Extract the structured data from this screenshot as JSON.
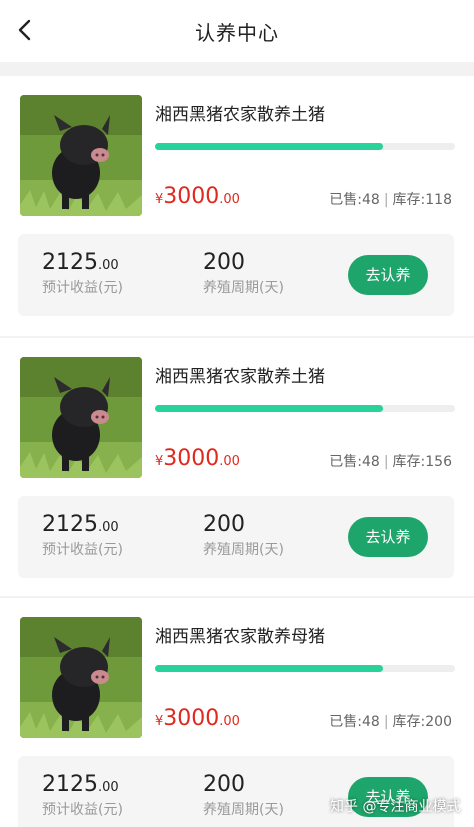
{
  "nav": {
    "title": "认养中心",
    "back_icon": "chevron-left-icon"
  },
  "colors": {
    "accent": "#27d39a",
    "button": "#1ea56b",
    "price": "#e0281e"
  },
  "cards": [
    {
      "name": "湘西黑猪农家散养土猪",
      "progress_percent": 76,
      "price": {
        "currency": "¥",
        "integer": "3000",
        "decimal": ".00"
      },
      "sold_label": "已售:48",
      "stock_label": "库存:118",
      "income": {
        "integer": "2125",
        "decimal": ".00",
        "label": "预计收益(元)"
      },
      "period": {
        "value": "200",
        "label": "养殖周期(天)"
      },
      "button": "去认养"
    },
    {
      "name": "湘西黑猪农家散养土猪",
      "progress_percent": 76,
      "price": {
        "currency": "¥",
        "integer": "3000",
        "decimal": ".00"
      },
      "sold_label": "已售:48",
      "stock_label": "库存:156",
      "income": {
        "integer": "2125",
        "decimal": ".00",
        "label": "预计收益(元)"
      },
      "period": {
        "value": "200",
        "label": "养殖周期(天)"
      },
      "button": "去认养"
    },
    {
      "name": "湘西黑猪农家散养母猪",
      "progress_percent": 76,
      "price": {
        "currency": "¥",
        "integer": "3000",
        "decimal": ".00"
      },
      "sold_label": "已售:48",
      "stock_label": "库存:200",
      "income": {
        "integer": "2125",
        "decimal": ".00",
        "label": "预计收益(元)"
      },
      "period": {
        "value": "200",
        "label": "养殖周期(天)"
      },
      "button": "去认养"
    }
  ],
  "watermark": "知乎 @专注商业模式"
}
